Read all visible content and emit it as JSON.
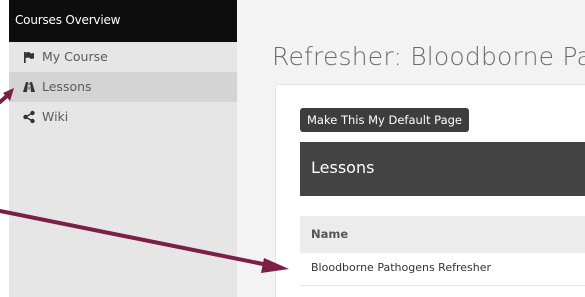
{
  "sidebar": {
    "header": "Courses Overview",
    "items": [
      {
        "label": "My Course",
        "icon": "flag-icon",
        "active": false
      },
      {
        "label": "Lessons",
        "icon": "road-icon",
        "active": true
      },
      {
        "label": "Wiki",
        "icon": "share-icon",
        "active": false
      }
    ]
  },
  "main": {
    "title": "Refresher: Bloodborne Pa",
    "default_button": "Make This My Default Page",
    "section_title": "Lessons",
    "table": {
      "headers": [
        "Name"
      ],
      "rows": [
        [
          "Bloodborne Pathogens Refresher"
        ]
      ]
    }
  },
  "colors": {
    "sidebar_bg": "#e6e6e6",
    "sidebar_header_bg": "#0d0d0d",
    "active_item_bg": "#d4d4d4",
    "section_header_bg": "#434343",
    "annotation_arrow": "#7a1f45"
  }
}
